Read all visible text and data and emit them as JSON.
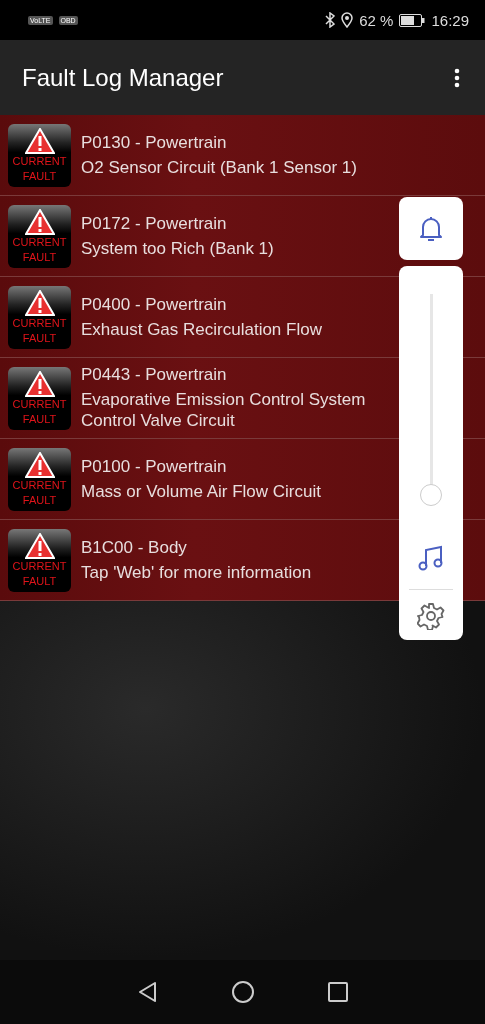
{
  "status_bar": {
    "badges": [
      "VoLTE",
      "OBD"
    ],
    "battery": "62 %",
    "time": "16:29"
  },
  "app_bar": {
    "title": "Fault Log Manager"
  },
  "faults": [
    {
      "badge": [
        "CURRENT",
        "FAULT"
      ],
      "code": "P0130 - Powertrain",
      "description": "O2 Sensor Circuit (Bank 1 Sensor 1)"
    },
    {
      "badge": [
        "CURRENT",
        "FAULT"
      ],
      "code": "P0172 - Powertrain",
      "description": "System too Rich (Bank 1)"
    },
    {
      "badge": [
        "CURRENT",
        "FAULT"
      ],
      "code": "P0400 - Powertrain",
      "description": "Exhaust Gas Recirculation Flow"
    },
    {
      "badge": [
        "CURRENT",
        "FAULT"
      ],
      "code": "P0443 - Powertrain",
      "description": "Evaporative Emission Control System Control Valve Circuit"
    },
    {
      "badge": [
        "CURRENT",
        "FAULT"
      ],
      "code": "P0100 - Powertrain",
      "description": "Mass or Volume Air Flow Circuit"
    },
    {
      "badge": [
        "CURRENT",
        "FAULT"
      ],
      "code": "B1C00 - Body",
      "description": "Tap 'Web' for more information"
    }
  ],
  "volume_panel": {
    "level": 0.02
  }
}
